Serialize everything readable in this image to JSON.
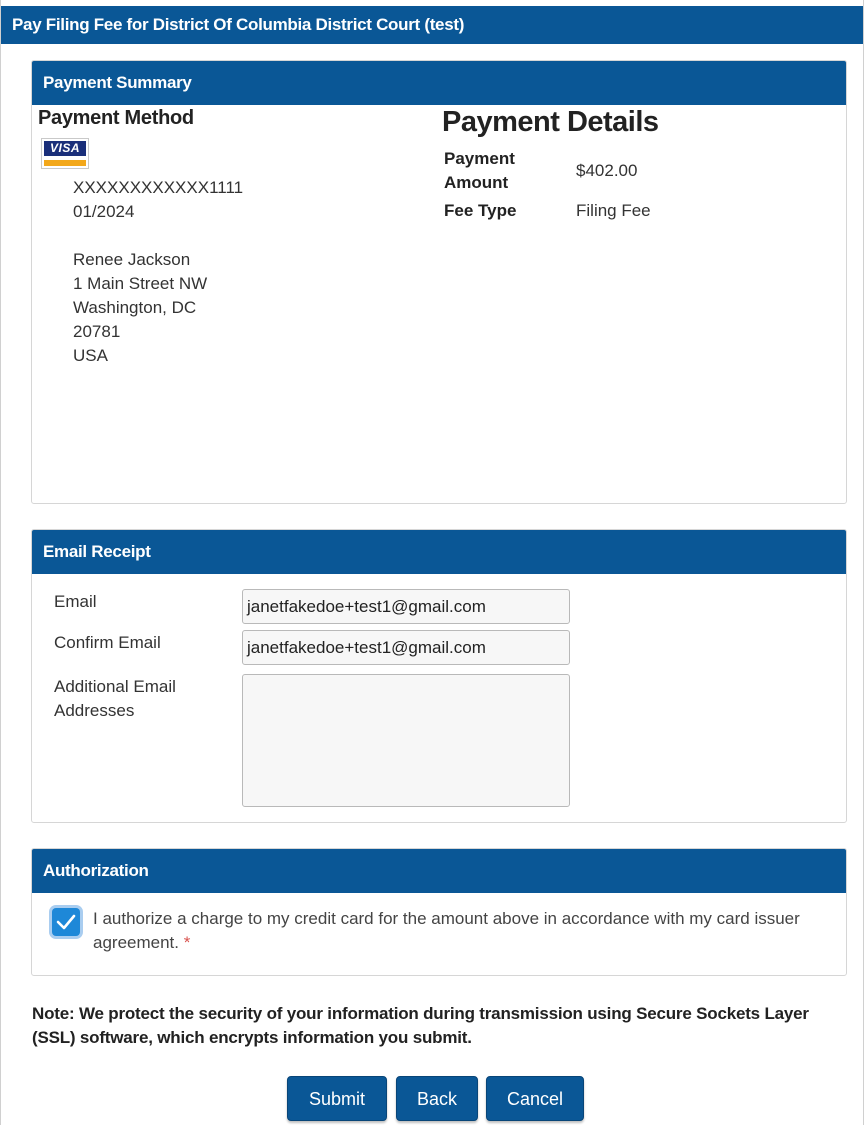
{
  "header": {
    "title": "Pay Filing Fee for District Of Columbia District Court (test)"
  },
  "payment_summary": {
    "heading": "Payment Summary",
    "method_title": "Payment Method",
    "card_brand": "VISA",
    "card_number": "XXXXXXXXXXXX1111",
    "card_expiry": "01/2024",
    "address": {
      "name": "Renee Jackson",
      "street": "1 Main Street NW",
      "city_state": "Washington, DC",
      "zip": "20781",
      "country": "USA"
    },
    "details_title": "Payment Details",
    "amount_label_line1": "Payment",
    "amount_label_line2": "Amount",
    "amount_value": "$402.00",
    "fee_type_label": "Fee Type",
    "fee_type_value": "Filing Fee"
  },
  "email_receipt": {
    "heading": "Email Receipt",
    "email_label": "Email",
    "email_value": "janetfakedoe+test1@gmail.com",
    "confirm_label": "Confirm Email",
    "confirm_value": "janetfakedoe+test1@gmail.com",
    "additional_label_line1": "Additional Email",
    "additional_label_line2": "Addresses",
    "additional_value": ""
  },
  "authorization": {
    "heading": "Authorization",
    "checked": true,
    "text": "I authorize a charge to my credit card for the amount above in accordance with my card issuer agreement.",
    "required_mark": "*"
  },
  "note": "Note: We protect the security of your information during transmission using Secure Sockets Layer (SSL) software, which encrypts information you submit.",
  "buttons": {
    "submit": "Submit",
    "back": "Back",
    "cancel": "Cancel"
  },
  "colors": {
    "header_blue": "#0a5796",
    "checkbox_blue": "#1e88d8",
    "card_brand_blue": "#1a2f7a",
    "card_brand_gold": "#f3a81b",
    "required_red": "#d9534f"
  }
}
